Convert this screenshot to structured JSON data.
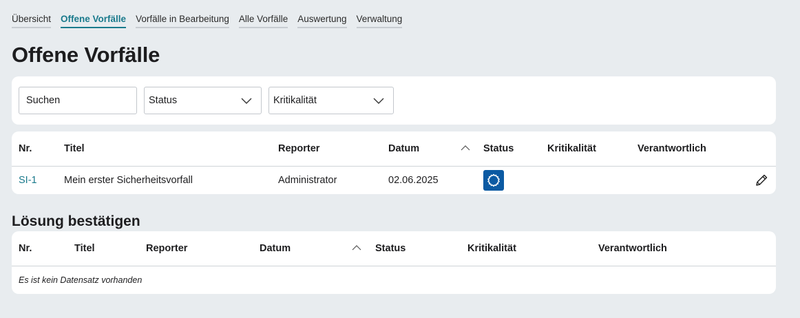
{
  "nav": {
    "items": [
      {
        "label": "Übersicht",
        "active": false
      },
      {
        "label": "Offene Vorfälle",
        "active": true
      },
      {
        "label": "Vorfälle in Bearbeitung",
        "active": false
      },
      {
        "label": "Alle Vorfälle",
        "active": false
      },
      {
        "label": "Auswertung",
        "active": false
      },
      {
        "label": "Verwaltung",
        "active": false
      }
    ]
  },
  "page": {
    "title": "Offene Vorfälle"
  },
  "filters": {
    "search_placeholder": "Suchen",
    "status_label": "Status",
    "criticality_label": "Kritikalität"
  },
  "open_table": {
    "headers": {
      "nr": "Nr.",
      "title": "Titel",
      "reporter": "Reporter",
      "date": "Datum",
      "status": "Status",
      "criticality": "Kritikalität",
      "responsible": "Verantwortlich"
    },
    "rows": [
      {
        "nr": "SI-1",
        "title": "Mein erster Sicherheitsvorfall",
        "reporter": "Administrator",
        "date": "02.06.2025",
        "status_icon": "gear-icon",
        "criticality": "",
        "responsible": ""
      }
    ]
  },
  "solution_section": {
    "title": "Lösung bestätigen",
    "headers": {
      "nr": "Nr.",
      "title": "Titel",
      "reporter": "Reporter",
      "date": "Datum",
      "status": "Status",
      "criticality": "Kritikalität",
      "responsible": "Verantwortlich"
    },
    "empty_text": "Es ist kein Datensatz vorhanden"
  },
  "colors": {
    "accent": "#1a7a8c",
    "status_badge": "#0b5aa3",
    "background": "#e8ecef"
  }
}
